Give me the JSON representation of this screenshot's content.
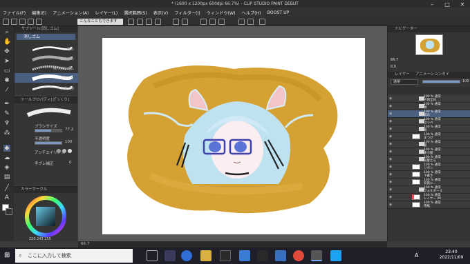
{
  "window": {
    "title": "* (1600 x 1200px 600dpi 66.7%) - CLIP STUDIO PAINT DEBUT"
  },
  "menu": [
    "ファイル(F)",
    "編集(E)",
    "アニメーション(A)",
    "レイヤー(L)",
    "選択範囲(S)",
    "表示(V)",
    "フィルター(I)",
    "ウィンドウ(W)",
    "ヘルプ(H)",
    "BOOST UP"
  ],
  "command_bar": {
    "notice": "こんなこともできます"
  },
  "subtool": {
    "header": "サブツール[消しゴム]",
    "active_tab": "消しゴム",
    "brushes": [
      {
        "label": "硬め"
      },
      {
        "label": "軟らかめ"
      },
      {
        "label": "擦り消しゴム"
      },
      {
        "label": "ざっくり"
      },
      {
        "label": "ベクター用"
      }
    ]
  },
  "tool_property": {
    "header": "ツールプロパティ[ざっくり]",
    "brush_size_label": "ブラシサイズ",
    "brush_size_value": "77.2",
    "opacity_label": "不透明度",
    "opacity_value": "100",
    "antialias_label": "アンチエイリアス",
    "stabilization_label": "手ブレ補正",
    "stabilization_value": "0"
  },
  "color": {
    "header": "カラーサークル",
    "r": "220",
    "g": "243",
    "b": "255",
    "value_readout": "220 243 255"
  },
  "navigator": {
    "header": "ナビゲーター",
    "zoom": "66.7",
    "angle": "0.0"
  },
  "layers": {
    "header": "レイヤー",
    "header2": "アニメーションタイ",
    "blend_mode": "通常",
    "opacity": "100",
    "items": [
      {
        "name": "100 % 通常",
        "sub": "人物全体"
      },
      {
        "name": "100 % 通常",
        "sub": "顔"
      },
      {
        "name": "100 % 通常",
        "sub": "耳の"
      },
      {
        "name": "100 % 通常",
        "sub": "ほっぺ"
      },
      {
        "name": "100 % 通常",
        "sub": "目"
      },
      {
        "name": "100 % 通常",
        "sub": "まつげ"
      },
      {
        "name": "100 % 通常",
        "sub": "髪"
      },
      {
        "name": "100 % 通常",
        "sub": "後ろ髪"
      },
      {
        "name": "100 % 通常",
        "sub": "前髪たら"
      },
      {
        "name": "100 % 通常",
        "sub": "リボン"
      },
      {
        "name": "100 % 通常",
        "sub": "下書き"
      },
      {
        "name": "100 % 通常",
        "sub": "背景に…"
      },
      {
        "name": "100 % 通常",
        "sub": "フォルダー 4"
      },
      {
        "name": "100 % 通常",
        "sub": "レイヤー 40"
      },
      {
        "name": "100 % 通常",
        "sub": "用紙"
      }
    ]
  },
  "status": {
    "zoom": "66.7"
  },
  "taskbar": {
    "search_placeholder": "ここに入力して検索",
    "time": "23:40",
    "date": "2022/11/09",
    "ime": "A"
  }
}
